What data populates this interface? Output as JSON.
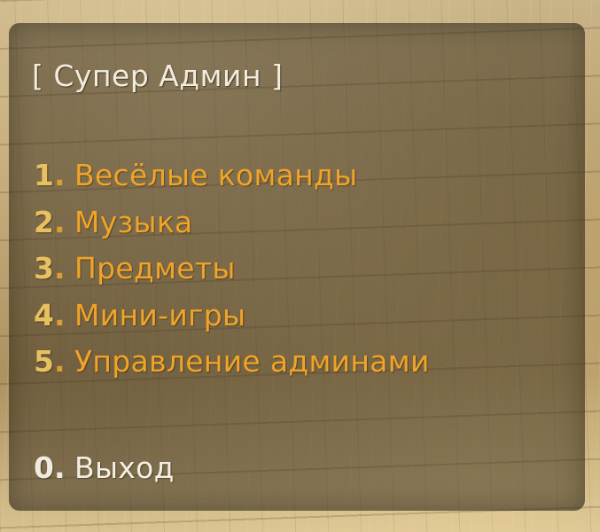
{
  "menu": {
    "title": "Супер Админ",
    "title_open": "[",
    "title_close": "]",
    "items": [
      {
        "number": "1",
        "label": "Весёлые команды"
      },
      {
        "number": "2",
        "label": "Музыка"
      },
      {
        "number": "3",
        "label": "Предметы"
      },
      {
        "number": "4",
        "label": "Мини-игры"
      },
      {
        "number": "5",
        "label": "Управление админами"
      }
    ],
    "exit": {
      "number": "0",
      "label": "Выход"
    },
    "separator": "."
  },
  "colors": {
    "item_label": "#f0a428",
    "item_number": "#e8c060",
    "exit_text": "#f4efe4",
    "panel": "#3a301e"
  }
}
